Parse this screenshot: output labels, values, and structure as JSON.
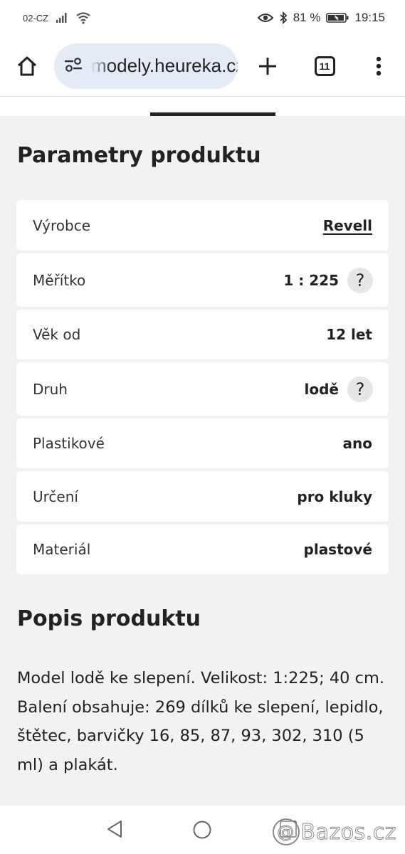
{
  "status_bar": {
    "carrier": "02-CZ",
    "battery": "81 %",
    "time": "19:15"
  },
  "browser": {
    "url": "modely.heureka.cz",
    "tab_count": "11"
  },
  "params_section": {
    "title": "Parametry produktu",
    "rows": [
      {
        "label": "Výrobce",
        "value": "Revell",
        "link": true,
        "help": false
      },
      {
        "label": "Měřítko",
        "value": "1 : 225",
        "link": false,
        "help": true
      },
      {
        "label": "Věk od",
        "value": "12 let",
        "link": false,
        "help": false
      },
      {
        "label": "Druh",
        "value": "lodě",
        "link": false,
        "help": true
      },
      {
        "label": "Plastikové",
        "value": "ano",
        "link": false,
        "help": false
      },
      {
        "label": "Určení",
        "value": "pro kluky",
        "link": false,
        "help": false
      },
      {
        "label": "Materiál",
        "value": "plastové",
        "link": false,
        "help": false
      }
    ],
    "help_glyph": "?"
  },
  "description_section": {
    "title": "Popis produktu",
    "text": "Model lodě ke slepení. Velikost: 1:225; 40 cm. Balení obsahuje: 269 dílků ke slepení, lepidlo, štětec, barvičky 16, 85, 87, 93, 302, 310 (5 ml) a plakát."
  },
  "watermark": {
    "at": "@",
    "text": "Bazos.cz"
  },
  "icons": {
    "status": [
      "signal-icon",
      "wifi-icon",
      "eye-icon",
      "bluetooth-icon",
      "battery-icon"
    ],
    "browser": [
      "home-icon",
      "site-settings-icon",
      "plus-icon",
      "tabs-icon",
      "more-icon"
    ],
    "nav": [
      "back-icon",
      "home-circle-icon",
      "recent-apps-icon"
    ]
  },
  "colors": {
    "page_background": "#f2f2f2",
    "card_background": "#ffffff",
    "url_pill": "#e4ebf6",
    "text": "#222222",
    "help_button": "#e6e6e6",
    "tab_indicator": "#222222"
  }
}
